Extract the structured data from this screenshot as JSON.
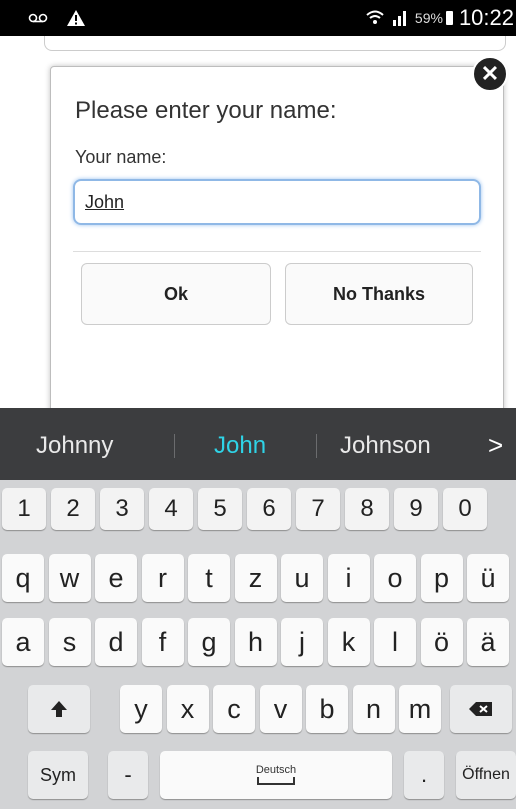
{
  "status_bar": {
    "battery": "59%",
    "time": "10:22"
  },
  "dialog": {
    "title": "Please enter your name:",
    "label": "Your name:",
    "input_value": "John",
    "ok_label": "Ok",
    "no_thanks_label": "No Thanks"
  },
  "keyboard": {
    "suggestions": [
      "Johnny",
      "John",
      "Johnson"
    ],
    "numbers": [
      "1",
      "2",
      "3",
      "4",
      "5",
      "6",
      "7",
      "8",
      "9",
      "0"
    ],
    "row1": [
      "q",
      "w",
      "e",
      "r",
      "t",
      "z",
      "u",
      "i",
      "o",
      "p",
      "ü"
    ],
    "row2": [
      "a",
      "s",
      "d",
      "f",
      "g",
      "h",
      "j",
      "k",
      "l",
      "ö",
      "ä"
    ],
    "row3": [
      "y",
      "x",
      "c",
      "v",
      "b",
      "n",
      "m"
    ],
    "sym_label": "Sym",
    "space_label": "Deutsch",
    "enter_label": "Öffnen",
    "minus": "-",
    "period": "."
  }
}
